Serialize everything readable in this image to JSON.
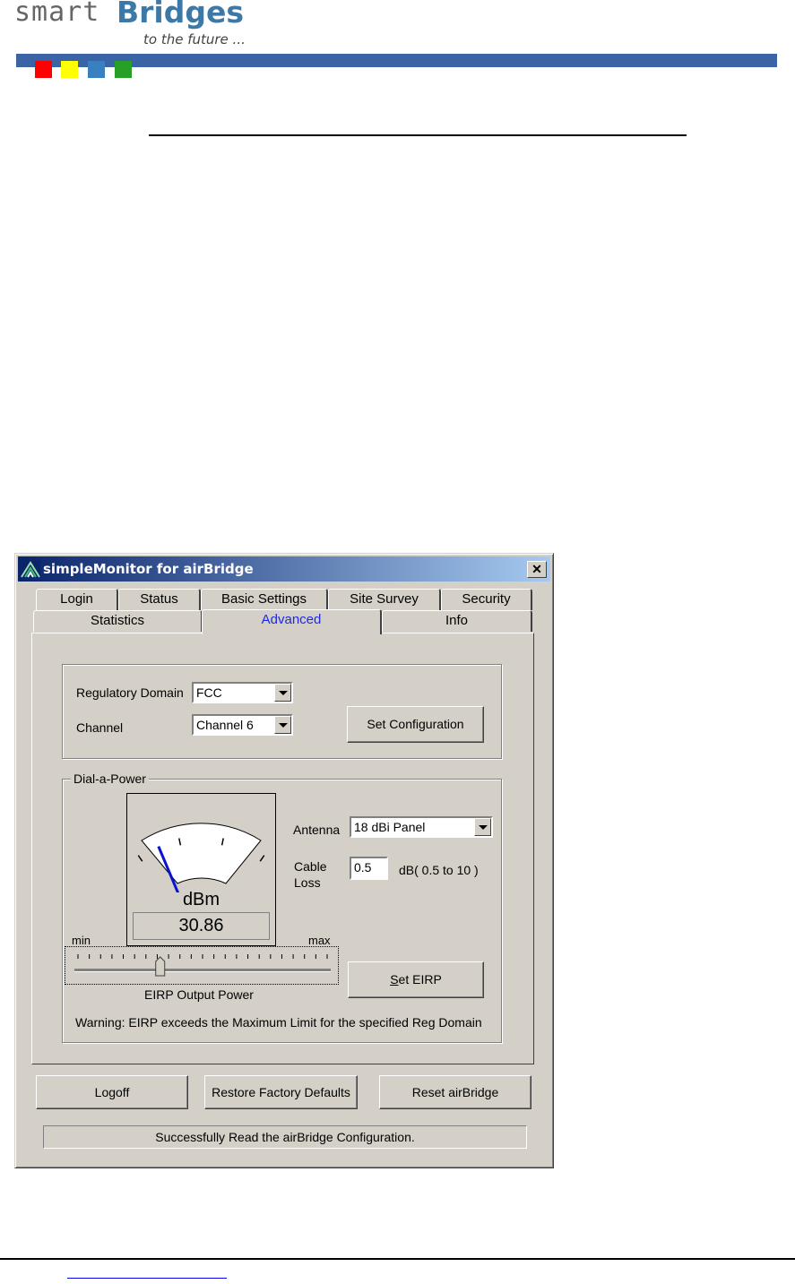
{
  "doc": {
    "logo_smart": "smart",
    "logo_bridges": "Bridges",
    "tagline": "to the future ...",
    "brand_squares": [
      "#ff0000",
      "#ffff00",
      "#3a7fbf",
      "#28a028"
    ]
  },
  "window": {
    "title": "simpleMonitor for airBridge",
    "close_label": "✕",
    "tabs_row1": [
      "Login",
      "Status",
      "Basic Settings",
      "Site Survey",
      "Security"
    ],
    "tabs_row2": [
      "Statistics",
      "Advanced",
      "Info"
    ],
    "active_tab": "Advanced"
  },
  "config": {
    "reg_domain_label": "Regulatory Domain",
    "reg_domain_value": "FCC",
    "channel_label": "Channel",
    "channel_value": "Channel 6",
    "set_config_button": "Set Configuration"
  },
  "dial": {
    "group_label": "Dial-a-Power",
    "unit": "dBm",
    "reading": "30.86",
    "needle_fraction": 0.3,
    "antenna_label": "Antenna",
    "antenna_value": "18 dBi Panel",
    "cable_label_1": "Cable",
    "cable_label_2": "Loss",
    "cable_value": "0.5",
    "cable_range": "dB( 0.5 to 10 )",
    "slider_min": "min",
    "slider_max": "max",
    "slider_fraction": 0.33,
    "slider_label": "EIRP Output Power",
    "set_eirp_prefix": "S",
    "set_eirp_rest": "et EIRP",
    "warning": "Warning: EIRP exceeds the Maximum Limit for the specified Reg Domain"
  },
  "bottom": {
    "logoff": "Logoff",
    "restore": "Restore Factory Defaults",
    "reset": "Reset airBridge",
    "status": "Successfully Read the airBridge Configuration."
  }
}
